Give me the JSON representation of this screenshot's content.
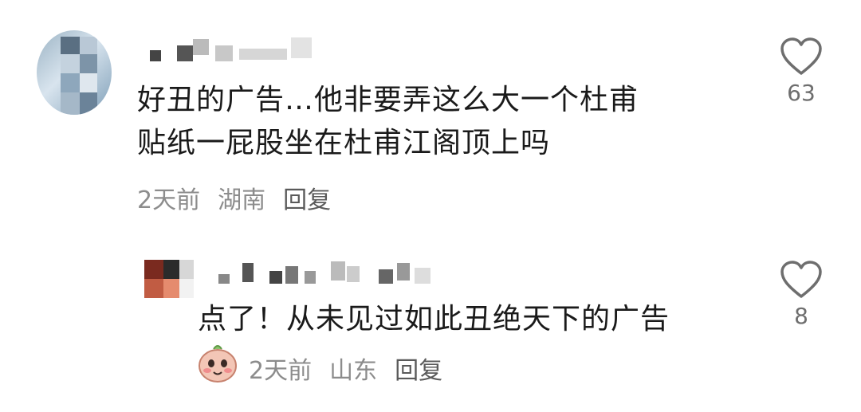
{
  "comments": [
    {
      "text_line1": "好丑的广告…他非要弄这么大一个杜甫",
      "text_line2": "贴纸一屁股坐在杜甫江阁顶上吗",
      "time": "2天前",
      "location": "湖南",
      "reply_label": "回复",
      "likes": "63"
    },
    {
      "text_line1": "点了！从未见过如此丑绝天下的广告",
      "time": "2天前",
      "location": "山东",
      "reply_label": "回复",
      "likes": "8"
    }
  ],
  "icons": {
    "like": "heart-outline-icon",
    "sticker": "face-sticker-icon"
  },
  "colors": {
    "text": "#1a1a1a",
    "meta": "#8c8c8c",
    "heart": "#6e6e6e"
  }
}
